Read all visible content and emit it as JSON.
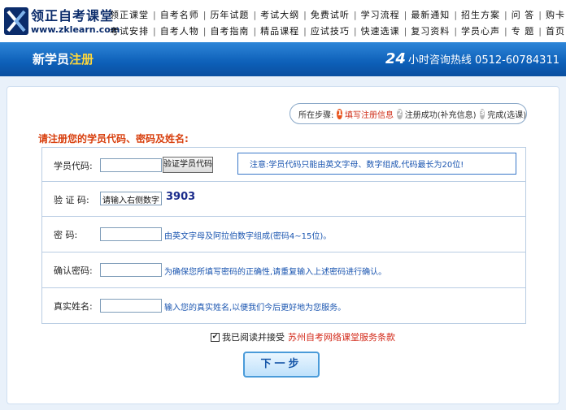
{
  "header": {
    "logo_cn": "领正自考课堂",
    "logo_en": "www.zklearn.com",
    "nav_row1": [
      "领正课堂",
      "自考名师",
      "历年试题",
      "考试大纲",
      "免费试听",
      "学习流程",
      "最新通知",
      "招生方案",
      "问 答",
      "购卡"
    ],
    "nav_row2": [
      "考试安排",
      "自考人物",
      "自考指南",
      "精品课程",
      "应试技巧",
      "快速选课",
      "复习资料",
      "学员心声",
      "专 题",
      "首页"
    ]
  },
  "banner": {
    "title_main": "新学员",
    "title_accent": "注册",
    "hotline_hours": "24",
    "hotline_text": "小时咨询热线 0512-60784311"
  },
  "steps": {
    "prefix": "所在步骤:",
    "items": [
      {
        "num": "1",
        "label": "填写注册信息",
        "active": true
      },
      {
        "num": "2",
        "label": "注册成功(补充信息)",
        "active": false
      },
      {
        "num": "3",
        "label": "完成(选课)",
        "active": false
      }
    ]
  },
  "form": {
    "heading": "请注册您的学员代码、密码及姓名:",
    "student_code": {
      "label": "学员代码:",
      "value": "",
      "verify_button": "验证学员代码",
      "notice": "注意:学员代码只能由英文字母、数字组成,代码最长为20位!"
    },
    "verify_code": {
      "label": "验 证 码:",
      "value": "请输入右侧数字",
      "captcha": "3903"
    },
    "password": {
      "label": "密    码:",
      "value": "",
      "hint": "由英文字母及阿拉伯数字组成(密码4~15位)。"
    },
    "confirm_password": {
      "label": "确认密码:",
      "value": "",
      "hint": "为确保您所填写密码的正确性,请重复输入上述密码进行确认。"
    },
    "real_name": {
      "label": "真实姓名:",
      "value": "",
      "hint": "输入您的真实姓名,以便我们今后更好地为您服务。"
    }
  },
  "agreement": {
    "checked": true,
    "text": "我已阅读并接受",
    "link": "苏州自考网络课堂服务条款"
  },
  "next_button": "下一步"
}
